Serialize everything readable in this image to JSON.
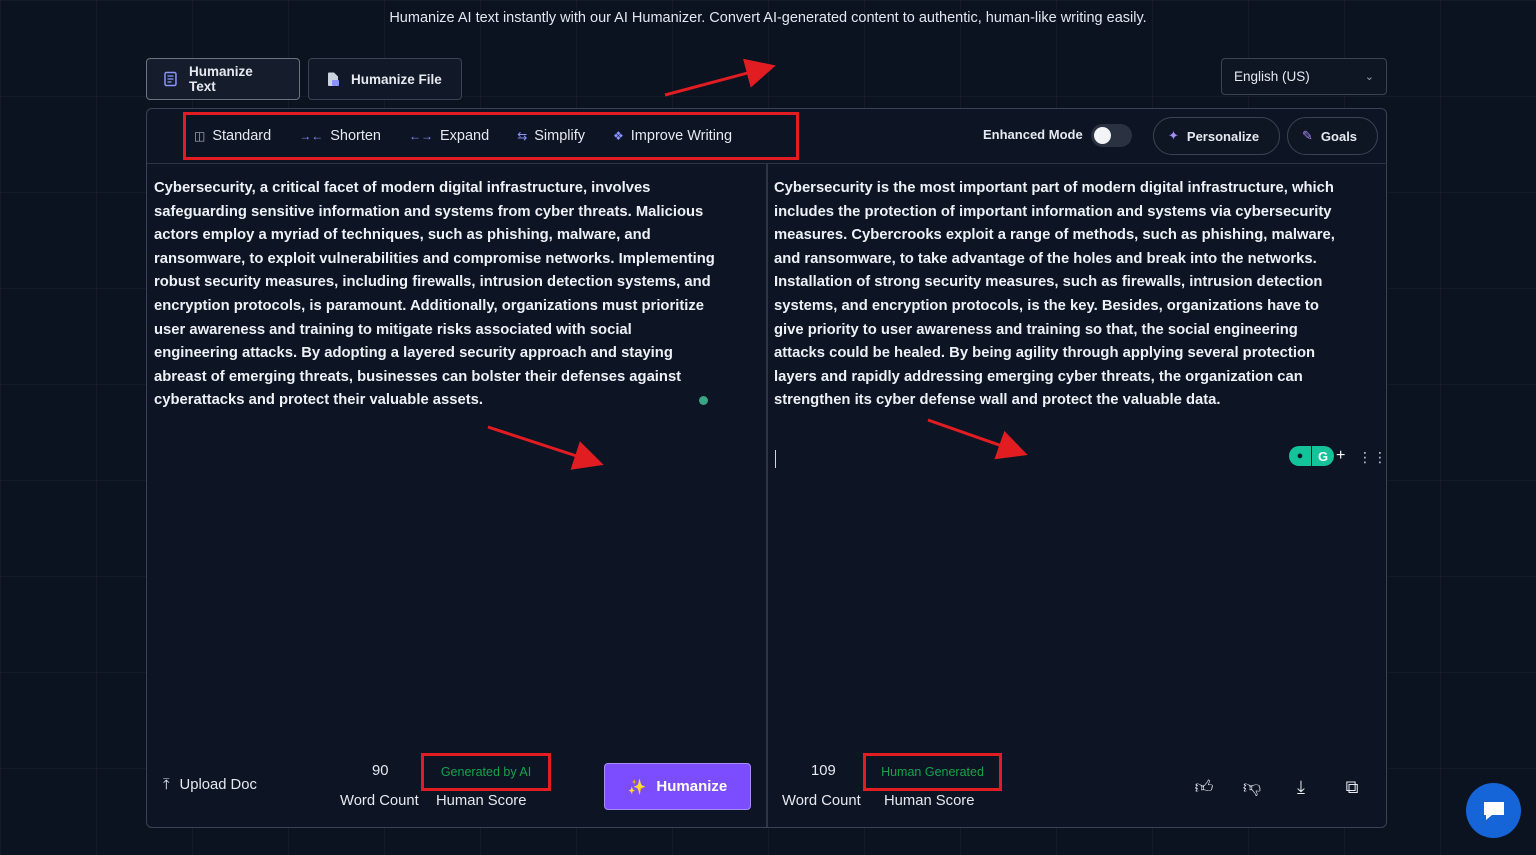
{
  "header": {
    "tagline": "Humanize AI text instantly with our AI Humanizer. Convert AI-generated content to authentic, human-like writing easily."
  },
  "tabs": [
    {
      "label": "Humanize Text",
      "icon": "document-icon",
      "active": true
    },
    {
      "label": "Humanize File",
      "icon": "file-icon",
      "active": false
    }
  ],
  "language": {
    "selected": "English (US)"
  },
  "modes": [
    {
      "label": "Standard",
      "icon": "box-icon",
      "selected": true
    },
    {
      "label": "Shorten",
      "icon": "shorten-arrows-icon",
      "selected": false
    },
    {
      "label": "Expand",
      "icon": "expand-arrows-icon",
      "selected": false
    },
    {
      "label": "Simplify",
      "icon": "swap-icon",
      "selected": false
    },
    {
      "label": "Improve Writing",
      "icon": "improve-icon",
      "selected": false
    }
  ],
  "enhanced_mode": {
    "label": "Enhanced Mode",
    "enabled": false
  },
  "personalize_label": "Personalize",
  "goals_label": "Goals",
  "input": {
    "text": "Cybersecurity, a critical facet of modern digital infrastructure, involves safeguarding sensitive information and systems from cyber threats. Malicious actors employ a myriad of techniques, such as phishing, malware, and ransomware, to exploit vulnerabilities and compromise networks. Implementing robust security measures, including firewalls, intrusion detection systems, and encryption protocols, is paramount. Additionally, organizations must prioritize user awareness and training to mitigate risks associated with social engineering attacks. By adopting a layered security approach and staying abreast of emerging threats, businesses can bolster their defenses against cyberattacks and protect their valuable assets.",
    "word_count": "90",
    "word_count_label": "Word Count",
    "human_score": "Generated by AI",
    "human_score_label": "Human Score",
    "upload_label": "Upload Doc",
    "humanize_label": "Humanize"
  },
  "output": {
    "text": "Cybersecurity is the most important part of modern digital infrastructure, which includes the protection of important information and systems via cybersecurity measures. Cybercrooks exploit a range of methods, such as phishing, malware, and ransomware, to take advantage of the holes and break into the networks. Installation of strong security measures, such as firewalls, intrusion detection systems, and encryption protocols, is the key. Besides, organizations have to give priority to user awareness and training so that, the social engineering attacks could be healed. By being agility through applying several protection layers and rapidly addressing emerging cyber threats, the organization can strengthen its cyber defense wall and protect the valuable data.",
    "word_count": "109",
    "word_count_label": "Word Count",
    "human_score": "Human Generated",
    "human_score_label": "Human Score"
  },
  "colors": {
    "accent": "#7c4dff",
    "highlight_box": "#e11d22",
    "status_green": "#16a34a",
    "chat_bubble": "#1565d8"
  }
}
